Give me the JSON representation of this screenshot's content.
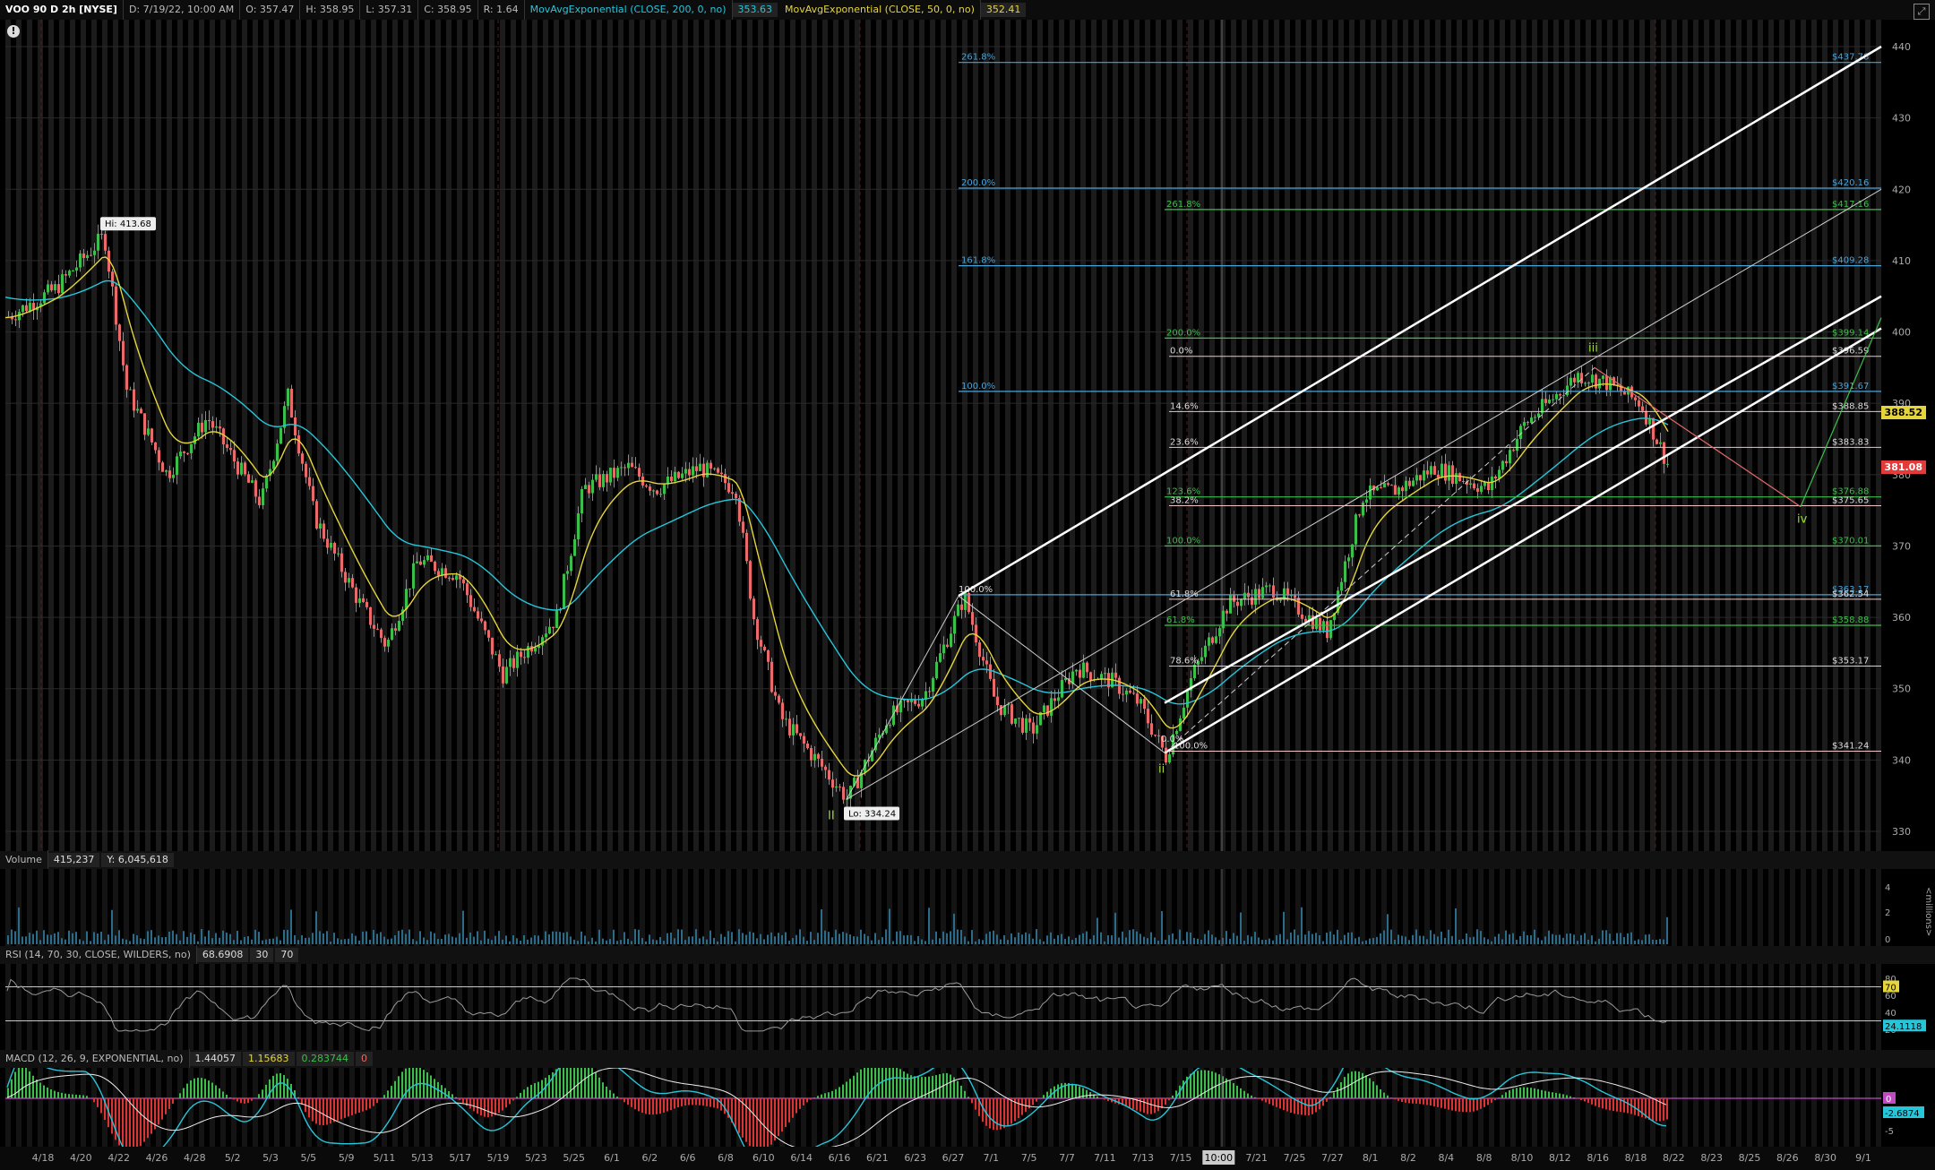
{
  "header": {
    "symbol": "VOO 90 D 2h [NYSE]",
    "date": "D: 7/19/22, 10:00 AM",
    "open": "O: 357.47",
    "high": "H: 358.95",
    "low": "L: 357.31",
    "close": "C: 358.95",
    "range": "R: 1.64",
    "ema200_label": "MovAvgExponential (CLOSE, 200, 0, no)",
    "ema200_value": "353.63",
    "ema50_label": "MovAvgExponential (CLOSE, 50, 0, no)",
    "ema50_value": "352.41"
  },
  "colors": {
    "ema200": "#26c6da",
    "ema50": "#e5d53b",
    "up": "#3cbf4a",
    "down": "#e86a6a",
    "fib_blue": "#4aa3d8",
    "fib_green": "#3cbf4a"
  },
  "price_axis": [
    "440",
    "430",
    "420",
    "410",
    "400",
    "390",
    "380",
    "370",
    "360",
    "350",
    "340",
    "330"
  ],
  "price_labels": {
    "current_yellow": "388.52",
    "current_red": "381.08"
  },
  "fib_right_labels": [
    "$437.78",
    "$420.16",
    "$417.16",
    "$409.28",
    "$399.14",
    "$396.59",
    "$391.67",
    "$388.85",
    "$383.83",
    "$376.88",
    "$375.65",
    "$370.01",
    "$363.17",
    "$362.54",
    "$358.88",
    "$353.17",
    "$341.24"
  ],
  "fib_left_labels": [
    "261.8%",
    "200.0%",
    "161.8%",
    "100.0%",
    "261.8%",
    "200.0%",
    "0.0%",
    "14.6%",
    "23.6%",
    "38.2%",
    "123.6%",
    "100.0%",
    "61.8%",
    "61.8%",
    "78.6%",
    "100.0%",
    "100.0%",
    "0.0%"
  ],
  "annotations": {
    "hi": "Hi: 413.68",
    "lo": "Lo: 334.24",
    "wave_ii_big": "II",
    "wave_ii": "ii",
    "wave_iii": "iii",
    "wave_iv": "iv"
  },
  "volume": {
    "label": "Volume",
    "v1": "415,237",
    "v2": "Y: 6,045,618",
    "axis": [
      "4",
      "2",
      "0"
    ],
    "unit": "<millions>"
  },
  "rsi": {
    "label": "RSI (14, 70, 30, CLOSE, WILDERS, no)",
    "value": "68.6908",
    "lower": "30",
    "upper": "70",
    "axis": [
      "80",
      "60",
      "40",
      "20"
    ],
    "marker70": "70",
    "current": "24.1118"
  },
  "macd": {
    "label": "MACD (12, 26, 9, EXPONENTIAL, no)",
    "v1": "1.44057",
    "v2": "1.15683",
    "v3": "0.283744",
    "v4": "0",
    "zero": "0",
    "current": "-2.6874",
    "axis": [
      "0",
      "-5"
    ]
  },
  "x_axis": [
    "4/18",
    "4/20",
    "4/22",
    "4/26",
    "4/28",
    "5/2",
    "5/3",
    "5/5",
    "5/9",
    "5/11",
    "5/13",
    "5/17",
    "5/19",
    "5/23",
    "5/25",
    "6/1",
    "6/2",
    "6/6",
    "6/8",
    "6/10",
    "6/14",
    "6/16",
    "6/21",
    "6/23",
    "6/27",
    "7/1",
    "7/5",
    "7/7",
    "7/11",
    "7/13",
    "7/15",
    "10:00",
    "7/21",
    "7/25",
    "7/27",
    "8/1",
    "8/2",
    "8/4",
    "8/8",
    "8/10",
    "8/12",
    "8/16",
    "8/18",
    "8/22",
    "8/23",
    "8/25",
    "8/26",
    "8/30",
    "9/1"
  ],
  "icons": {
    "info": "info-icon",
    "corner": "expand-icon"
  }
}
